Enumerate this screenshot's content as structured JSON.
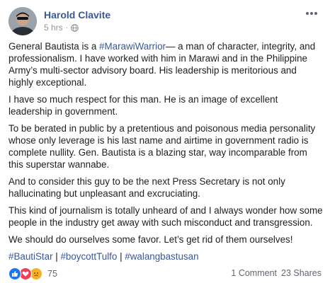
{
  "post": {
    "author": "Harold Clavite",
    "time": "5 hrs",
    "separator": "·",
    "paragraphs": [
      {
        "before": "General Bautista is a ",
        "hashtag": "#MarawiWarrior",
        "after": "— a man of character, integrity, and professionalism. I have worked with him in Marawi and in the Philippine Army’s multi-sector advisory board. His leadership is meritorious and highly exceptional."
      },
      {
        "text": "I have so much respect for this man. He is an image of excellent leadership in government."
      },
      {
        "text": "To be berated in public by a pretentious and poisonous media personality whose only leverage is his last name and airtime in government radio is complete nullity. Gen. Bautista is a blazing star, way incomparable from this superstar wannabe."
      },
      {
        "text": "And to consider this guy to be the next Press Secretary is not only hallucinating but unpleasant and excruciating."
      },
      {
        "text": "This kind of journalism is totally unheard of and I always wonder how some people in the industry get away with such misconduct and transgression."
      },
      {
        "text": "We should do ourselves some favor. Let’s get rid of them ourselves!"
      }
    ],
    "hashtags": [
      "#BautiStar",
      "#boycottTulfo",
      "#walangbastusan"
    ],
    "hashtag_separator": " | "
  },
  "footer": {
    "reaction_icons": [
      "like-icon",
      "love-icon",
      "sad-icon"
    ],
    "reaction_count": "75",
    "comments": "1 Comment",
    "shares": "23 Shares"
  },
  "colors": {
    "link": "#385898",
    "text": "#1c1e21",
    "meta": "#90949c",
    "like": "#1877f2",
    "love": "#f33e58",
    "sad": "#f7b125"
  }
}
